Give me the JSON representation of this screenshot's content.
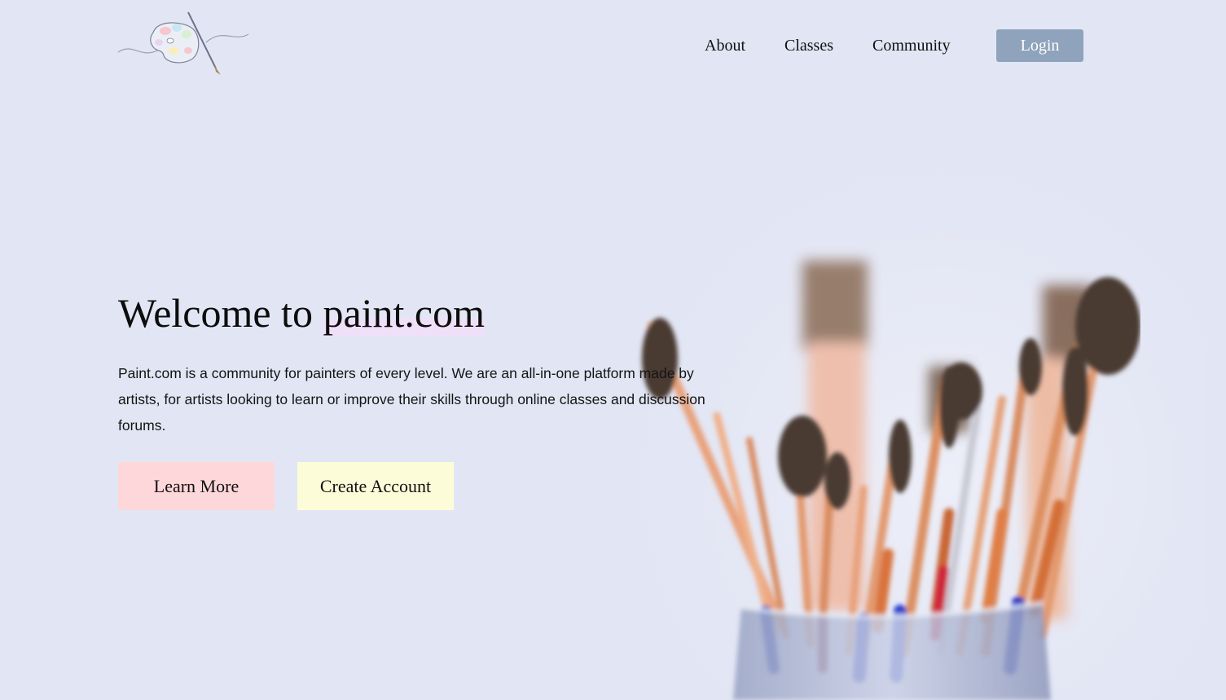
{
  "nav": {
    "about": "About",
    "classes": "Classes",
    "community": "Community",
    "login": "Login"
  },
  "hero": {
    "title_prefix": "Welcome to ",
    "title_highlight": "paint.com",
    "description": "Paint.com is a community for painters of every level. We are an all-in-one platform made by artists, for artists looking to learn or improve their skills through online classes and discussion forums.",
    "learn_more": "Learn More",
    "create_account": "Create Account"
  },
  "colors": {
    "background": "#e2e6f4",
    "login_button": "#8fa3bc",
    "learn_more_button": "#fdd7da",
    "create_account_button": "#fdfcd8",
    "title_highlight": "#f0dff8"
  },
  "icons": {
    "logo": "palette-and-brush-logo",
    "hero_image": "paintbrushes-in-jar-photo"
  }
}
